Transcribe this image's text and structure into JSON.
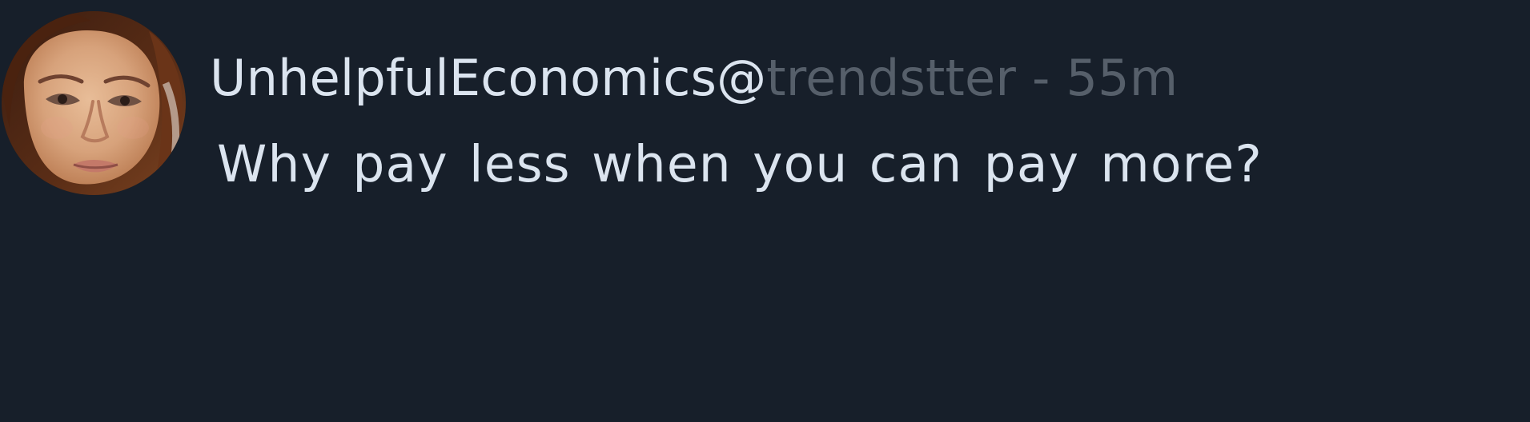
{
  "post": {
    "display_name": "UnhelpfulEconomics",
    "at_symbol": "@",
    "handle": "trendstter",
    "separator": " - ",
    "timestamp": "55m",
    "text": "Why pay less when you can pay more?",
    "avatar_icon": "profile-photo-woman-portrait"
  },
  "colors": {
    "background": "#171f2a",
    "primary_text": "#dbe4ef",
    "muted_text": "#565f6a"
  }
}
